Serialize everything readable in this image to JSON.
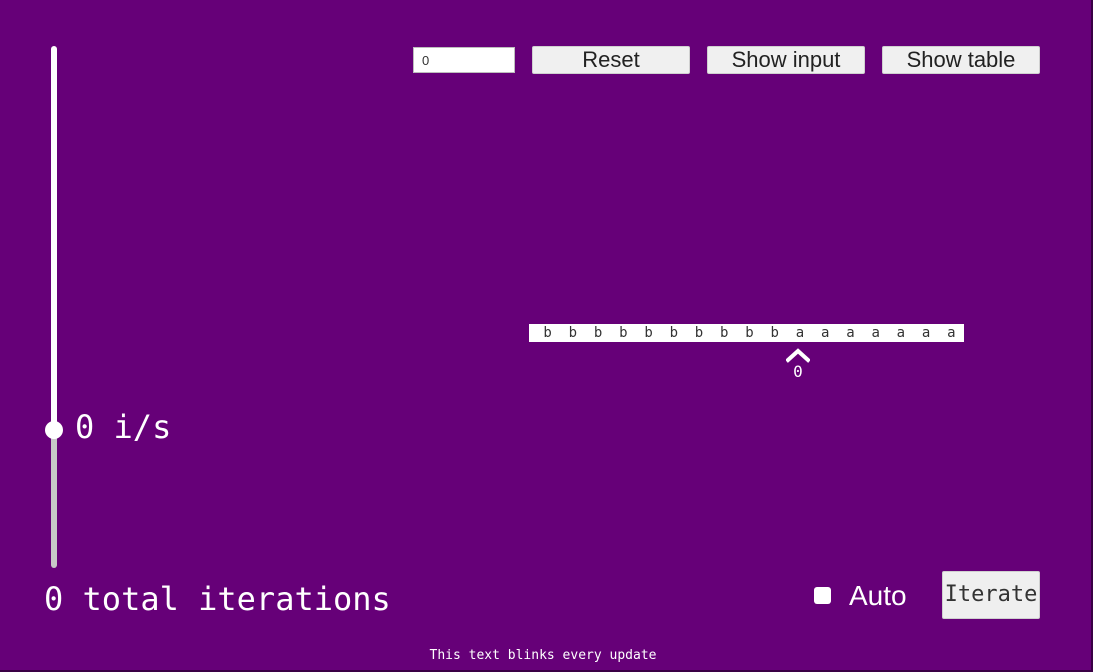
{
  "colors": {
    "background": "#660078",
    "foreground": "#ffffff",
    "slider_track_lower": "#c8c8c8",
    "button_bg": "#f0f0f0"
  },
  "speed_slider": {
    "value_fraction": 0.0,
    "readout": "0 i/s"
  },
  "stats": {
    "total_iterations": "0 total iterations"
  },
  "toolbar": {
    "input_value": "0",
    "reset_label": "Reset",
    "show_input_label": "Show input",
    "show_table_label": "Show table"
  },
  "tape": {
    "cells": [
      "b",
      "b",
      "b",
      "b",
      "b",
      "b",
      "b",
      "b",
      "b",
      "b",
      "a",
      "a",
      "a",
      "a",
      "a",
      "a",
      "a"
    ],
    "head_index": 10,
    "head_position_label": "0"
  },
  "controls": {
    "auto_label": "Auto",
    "auto_checked": false,
    "iterate_label": "Iterate"
  },
  "footer": {
    "blink_text": "This text blinks every update"
  },
  "icons": {
    "head": "chevron-up-icon"
  }
}
